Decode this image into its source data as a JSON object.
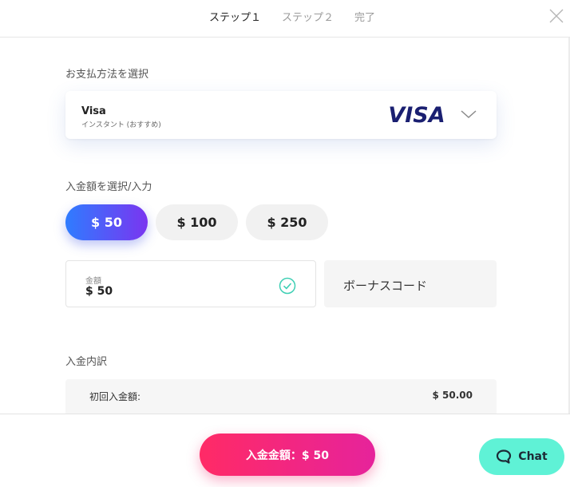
{
  "header": {
    "steps": [
      {
        "label": "ステップ１",
        "active": true
      },
      {
        "label": "ステップ２",
        "active": false
      },
      {
        "label": "完了",
        "active": false
      }
    ],
    "close_icon": "close-icon"
  },
  "payment": {
    "section_label": "お支払方法を選択",
    "method_name": "Visa",
    "method_sub": "インスタント (おすすめ)",
    "logo_text": "VISA",
    "logo_color": "#1a1f71"
  },
  "amount": {
    "section_label": "入金額を選択/入力",
    "presets": [
      {
        "label": "$ 50",
        "selected": true
      },
      {
        "label": "$ 100",
        "selected": false
      },
      {
        "label": "$ 250",
        "selected": false
      }
    ],
    "field_label": "金額",
    "field_value": "$ 50",
    "bonus_placeholder": "ボーナスコード"
  },
  "breakdown": {
    "section_label": "入金内訳",
    "rows": [
      {
        "label": "初回入金額:",
        "value": "$ 50.00"
      }
    ]
  },
  "footer": {
    "deposit_label": "入金金額：$ 50",
    "chat_label": "Chat"
  },
  "colors": {
    "accent_gradient_start": "#2f7cff",
    "accent_gradient_end": "#7a35f0",
    "cta_start": "#ff2a66",
    "cta_end": "#e6239b",
    "chat_bg": "#5ff2d6",
    "check": "#3fcfb4"
  }
}
